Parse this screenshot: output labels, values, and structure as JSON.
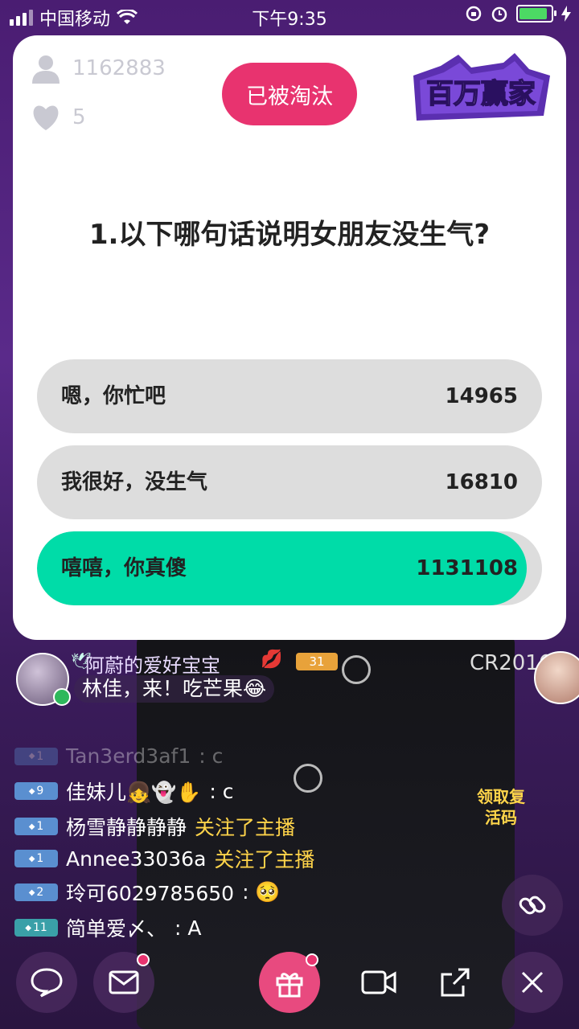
{
  "status_bar": {
    "carrier": "中国移动",
    "time": "下午9:35"
  },
  "quiz": {
    "viewers": "1162883",
    "lives": "5",
    "status_label": "已被淘汰",
    "logo_text": "百万赢家",
    "question": "1.以下哪句话说明女朋友没生气?",
    "options": [
      {
        "text": "嗯，你忙吧",
        "count": "14965",
        "share": 0.0,
        "correct": false
      },
      {
        "text": "我很好，没生气",
        "count": "16810",
        "share": 0.0,
        "correct": false
      },
      {
        "text": "嘻嘻，你真傻",
        "count": "1131108",
        "share": 0.97,
        "correct": true
      }
    ],
    "correct_color": "#00dca8"
  },
  "gift_banner": {
    "sender": "阿蔚的爱好宝宝",
    "badge_level": "31",
    "message": "林佳，来！吃芒果😂"
  },
  "chat": [
    {
      "level": "1",
      "user": "Tan3erd3af1",
      "text": ": c",
      "type": "msg"
    },
    {
      "level": "9",
      "user": "佳妹儿👧👻✋",
      "text": ": c",
      "type": "msg"
    },
    {
      "level": "1",
      "user": "杨雪静静静静",
      "text": "关注了主播",
      "type": "follow"
    },
    {
      "level": "1",
      "user": "Annee33036a",
      "text": "关注了主播",
      "type": "follow"
    },
    {
      "level": "2",
      "user": "玲可6029785650",
      "text": ": 🥺",
      "type": "msg"
    },
    {
      "level": "11",
      "user": "简单爱〆、",
      "text": ": A",
      "type": "msg"
    }
  ],
  "revive_label": "领取复活码",
  "background_text": "CR2016"
}
